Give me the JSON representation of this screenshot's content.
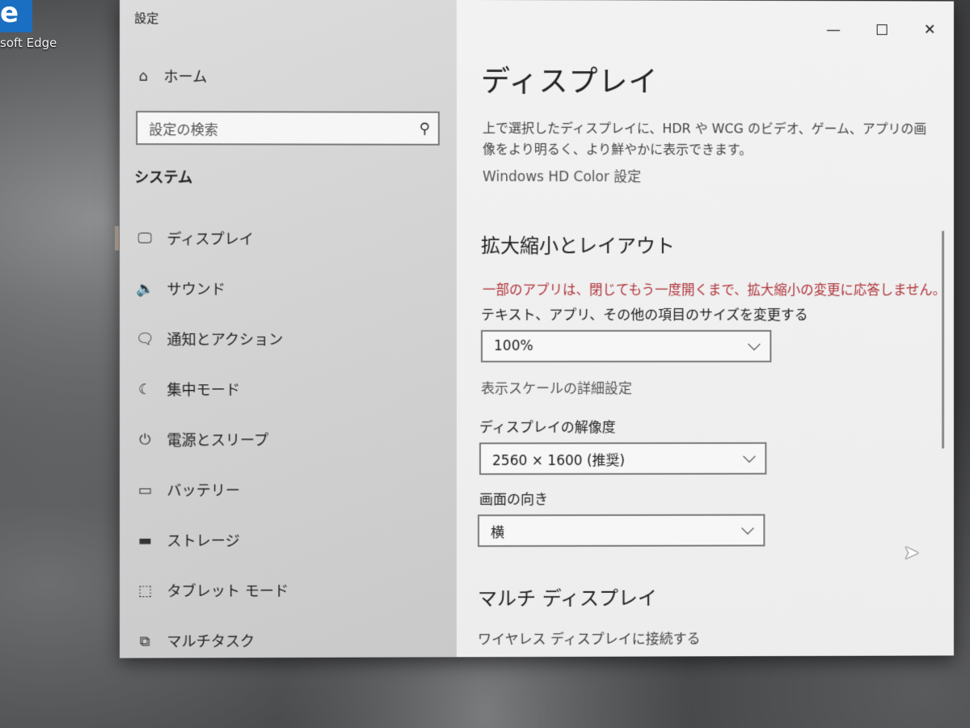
{
  "desktop": {
    "icon_letter": "e",
    "label": "soft Edge"
  },
  "window": {
    "title": "設定",
    "minimize": "—",
    "close": "✕"
  },
  "sidebar": {
    "home": "ホーム",
    "search_placeholder": "設定の検索",
    "section": "システム",
    "items": [
      {
        "label": "ディスプレイ",
        "icon": "monitor-icon",
        "glyph": "🖵"
      },
      {
        "label": "サウンド",
        "icon": "speaker-icon",
        "glyph": "🔈"
      },
      {
        "label": "通知とアクション",
        "icon": "notification-icon",
        "glyph": "🗨"
      },
      {
        "label": "集中モード",
        "icon": "moon-icon",
        "glyph": "☾"
      },
      {
        "label": "電源とスリープ",
        "icon": "power-icon",
        "glyph": "⏻"
      },
      {
        "label": "バッテリー",
        "icon": "battery-icon",
        "glyph": "▭"
      },
      {
        "label": "ストレージ",
        "icon": "storage-icon",
        "glyph": "▬"
      },
      {
        "label": "タブレット モード",
        "icon": "tablet-icon",
        "glyph": "⬚"
      },
      {
        "label": "マルチタスク",
        "icon": "multitask-icon",
        "glyph": "⧉"
      }
    ]
  },
  "main": {
    "title": "ディスプレイ",
    "hdr_desc": "上で選択したディスプレイに、HDR や WCG のビデオ、ゲーム、アプリの画像をより明るく、より鮮やかに表示できます。",
    "hdr_link": "Windows HD Color 設定",
    "scale_heading": "拡大縮小とレイアウト",
    "scale_warning": "一部のアプリは、閉じてもう一度開くまで、拡大縮小の変更に応答しません。",
    "size_label": "テキスト、アプリ、その他の項目のサイズを変更する",
    "size_value": "100%",
    "advanced_scale_link": "表示スケールの詳細設定",
    "resolution_label": "ディスプレイの解像度",
    "resolution_value": "2560 × 1600 (推奨)",
    "orientation_label": "画面の向き",
    "orientation_value": "横",
    "multi_heading": "マルチ ディスプレイ",
    "wireless_link": "ワイヤレス ディスプレイに接続する"
  },
  "colors": {
    "warning": "#b0333a",
    "sidebar_bg": "#d6d6d6",
    "main_bg": "#f0f0f0"
  }
}
